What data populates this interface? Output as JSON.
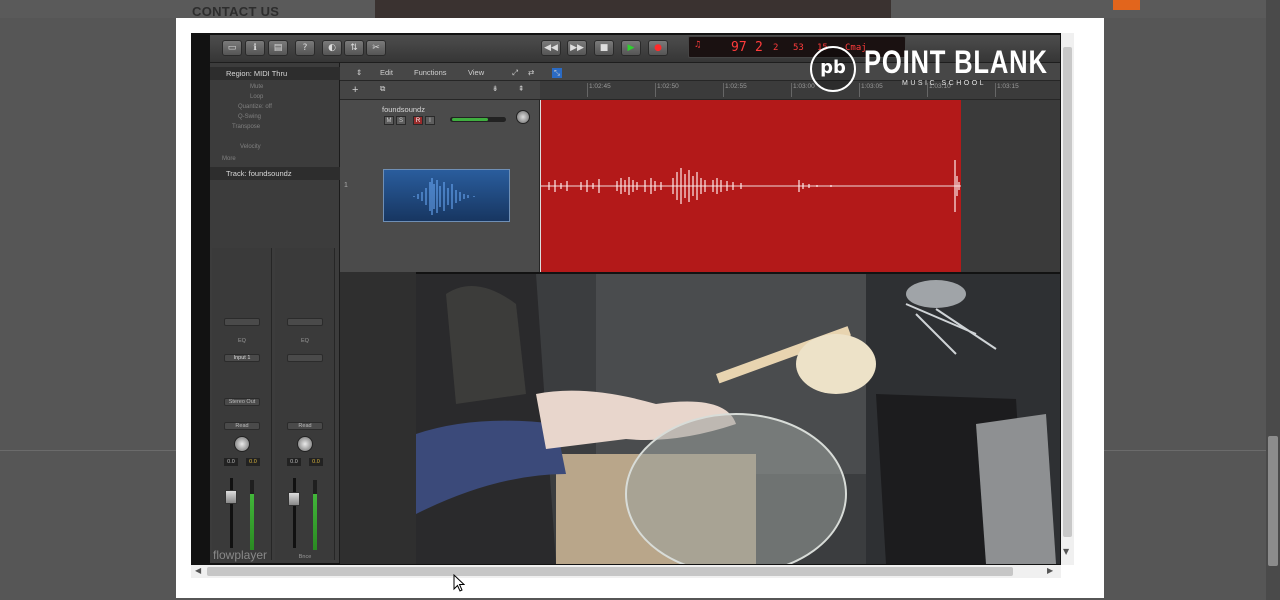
{
  "background_page": {
    "contact_label": "CONTACT US"
  },
  "daw": {
    "inspector": {
      "region_header": "Region: MIDI Thru",
      "region_params": [
        "Mute",
        "Loop",
        "Quantize: off",
        "Q-Swing",
        "Transpose",
        "Velocity",
        "More"
      ],
      "track_header": "Track: foundsoundz",
      "channel_strip_1": {
        "input": "Input 1",
        "output": "Stereo Out",
        "automation": "Read",
        "pan_value": "0.0",
        "gain_value": "0.0"
      },
      "channel_strip_2": {
        "automation": "Read",
        "pan_value": "0.0",
        "gain_value": "0.0",
        "name": "Bnce"
      }
    },
    "track_toolbar": {
      "menus": [
        "Edit",
        "Functions",
        "View"
      ]
    },
    "track": {
      "name": "foundsoundz",
      "number": "1",
      "buttons": [
        "M",
        "S",
        "R",
        "I"
      ]
    },
    "ruler_ticks": [
      "1:02:45",
      "1:02:50",
      "1:02:55",
      "1:03:00",
      "1:03:05",
      "1:03:10",
      "1:03:15"
    ],
    "lcd": {
      "tempo": "97",
      "bar": "2",
      "beat": "2",
      "tick": "53",
      "extra": "15",
      "key": "Cmaj"
    }
  },
  "logo": {
    "mark": "pb",
    "title": "POINT BLANK",
    "subtitle": "MUSIC SCHOOL"
  },
  "player": {
    "brand": "flowplayer"
  },
  "colors": {
    "region_red": "#b31919",
    "accent_orange": "#e2651c",
    "meter_green": "#42b63a"
  }
}
